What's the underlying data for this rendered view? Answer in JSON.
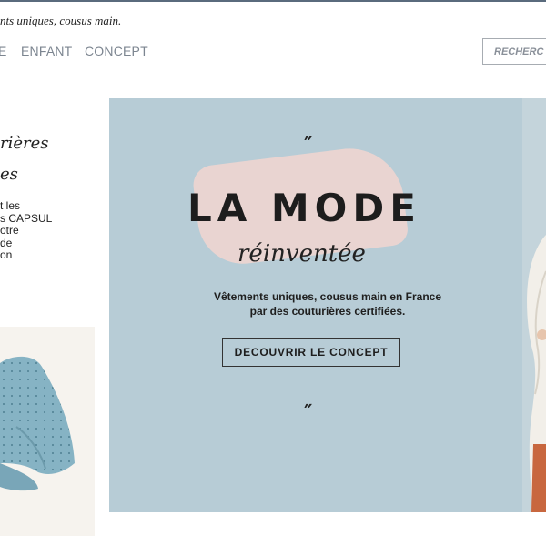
{
  "header": {
    "tagline": "nts uniques, cousus main."
  },
  "nav": {
    "items": [
      "E",
      "ENFANT",
      "CONCEPT"
    ]
  },
  "search": {
    "placeholder": "RECHERC"
  },
  "sidebar": {
    "script_line1": "rières",
    "script_line2": "es",
    "text_lines": [
      "t les",
      "s CAPSUL",
      "otre",
      "de",
      "on"
    ]
  },
  "hero": {
    "quote_open": "˝",
    "title": "LA MODE",
    "script": "réinventée",
    "subtitle_lines": [
      "Vêtements uniques, cousus main en France",
      "par des couturières certifiées."
    ],
    "cta_label": "DECOUVRIR LE CONCEPT",
    "quote_close": "˝"
  },
  "colors": {
    "hero_background": "#b7ccd6",
    "brush_pink": "#edd5d0",
    "nav_gray": "#7c8590",
    "border_blue": "#5a6b7d"
  }
}
